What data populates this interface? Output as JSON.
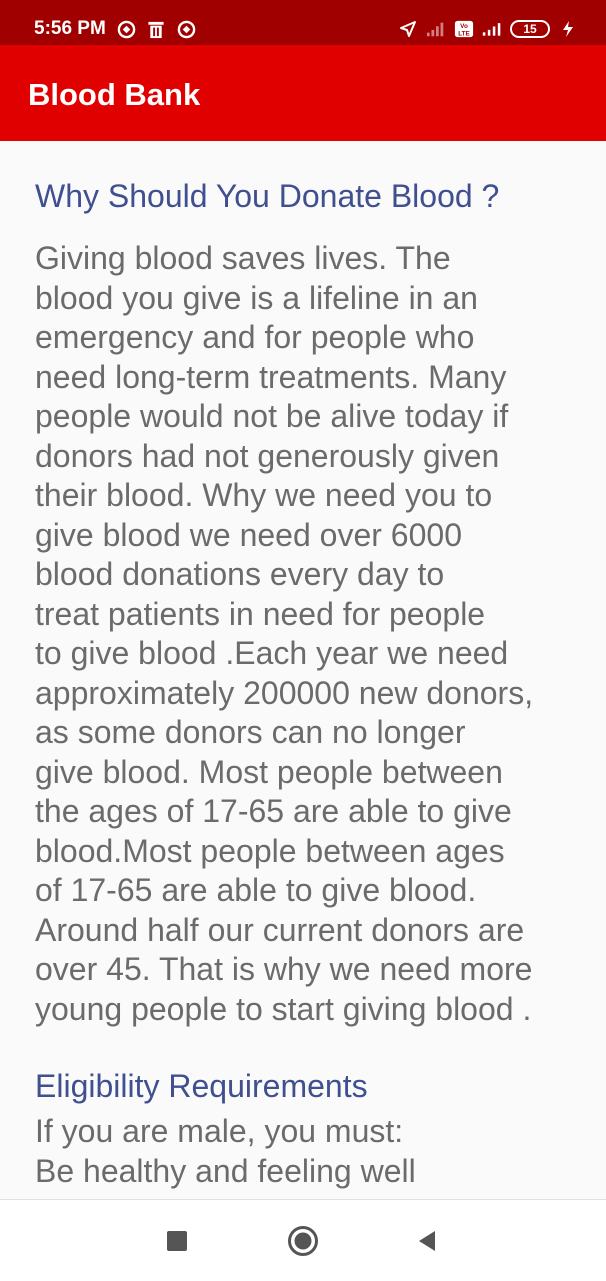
{
  "status_bar": {
    "time": "5:56 PM",
    "battery": "15",
    "icons": [
      "notification-icon",
      "delete-icon",
      "notification-icon",
      "location-icon",
      "signal-icon",
      "volte-icon",
      "signal-icon",
      "battery-icon",
      "charging-icon"
    ]
  },
  "app_bar": {
    "title": "Blood Bank"
  },
  "content": {
    "section1": {
      "heading": "Why Should You Donate Blood ?",
      "lines": [
        "Giving blood saves lives. The",
        "blood you give is a lifeline in an",
        "emergency and for people who",
        "need long-term treatments. Many",
        "people would not be alive today if",
        "donors had not generously given",
        "their blood. Why we need you to",
        "give blood we need over 6000",
        "blood donations every day to",
        "treat patients in need for people",
        "to give blood .Each year we need",
        "approximately 200000 new donors,",
        "as some donors can no longer",
        "give blood. Most people between",
        "the ages of 17-65 are able to give",
        "blood.Most people between ages",
        "of 17-65 are able to give blood.",
        "Around half our current donors are",
        "over 45. That is why we need more",
        "young people to start giving blood ."
      ]
    },
    "section2": {
      "heading": "Eligibility Requirements",
      "lines": [
        "If you are male, you must:",
        "Be healthy and feeling well"
      ]
    }
  },
  "colors": {
    "status_bar": "#a10000",
    "app_bar": "#e00000",
    "heading": "#3f4f8f",
    "body_text": "#6b6b6b"
  },
  "nav_bar": {
    "buttons": [
      "recent-apps-icon",
      "home-icon",
      "back-icon"
    ]
  }
}
